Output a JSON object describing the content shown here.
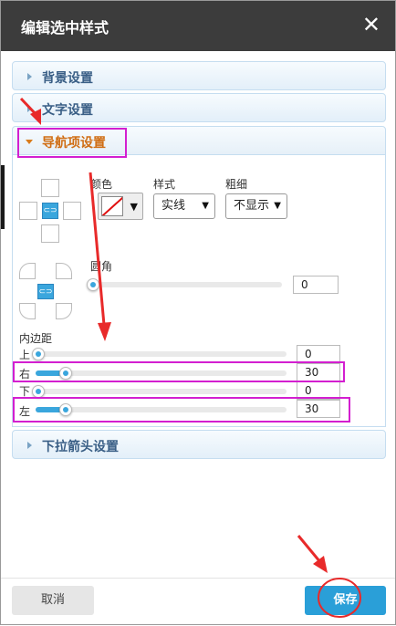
{
  "dialog": {
    "title": "编辑选中样式",
    "close_icon": "close-icon"
  },
  "sections": {
    "background": "背景设置",
    "text": "文字设置",
    "nav_item": "导航项设置",
    "dropdown_arrow": "下拉箭头设置"
  },
  "border": {
    "color_label": "颜色",
    "style_label": "样式",
    "style_value": "实线",
    "thickness_label": "粗细",
    "thickness_value": "不显示"
  },
  "radius": {
    "label": "圆角",
    "value": "0",
    "level": 0
  },
  "padding": {
    "label": "内边距",
    "top_label": "上",
    "top_value": "0",
    "top_level": 0,
    "right_label": "右",
    "right_value": "30",
    "right_level": 0.11,
    "bottom_label": "下",
    "bottom_value": "0",
    "bottom_level": 0,
    "left_label": "左",
    "left_value": "30",
    "left_level": 0.11
  },
  "buttons": {
    "cancel": "取消",
    "save": "保存"
  },
  "colors": {
    "titlebar": "#3c3c3c",
    "accent": "#3aa6dd",
    "highlight": "#d31fd0",
    "annotation": "#e82a2a"
  }
}
